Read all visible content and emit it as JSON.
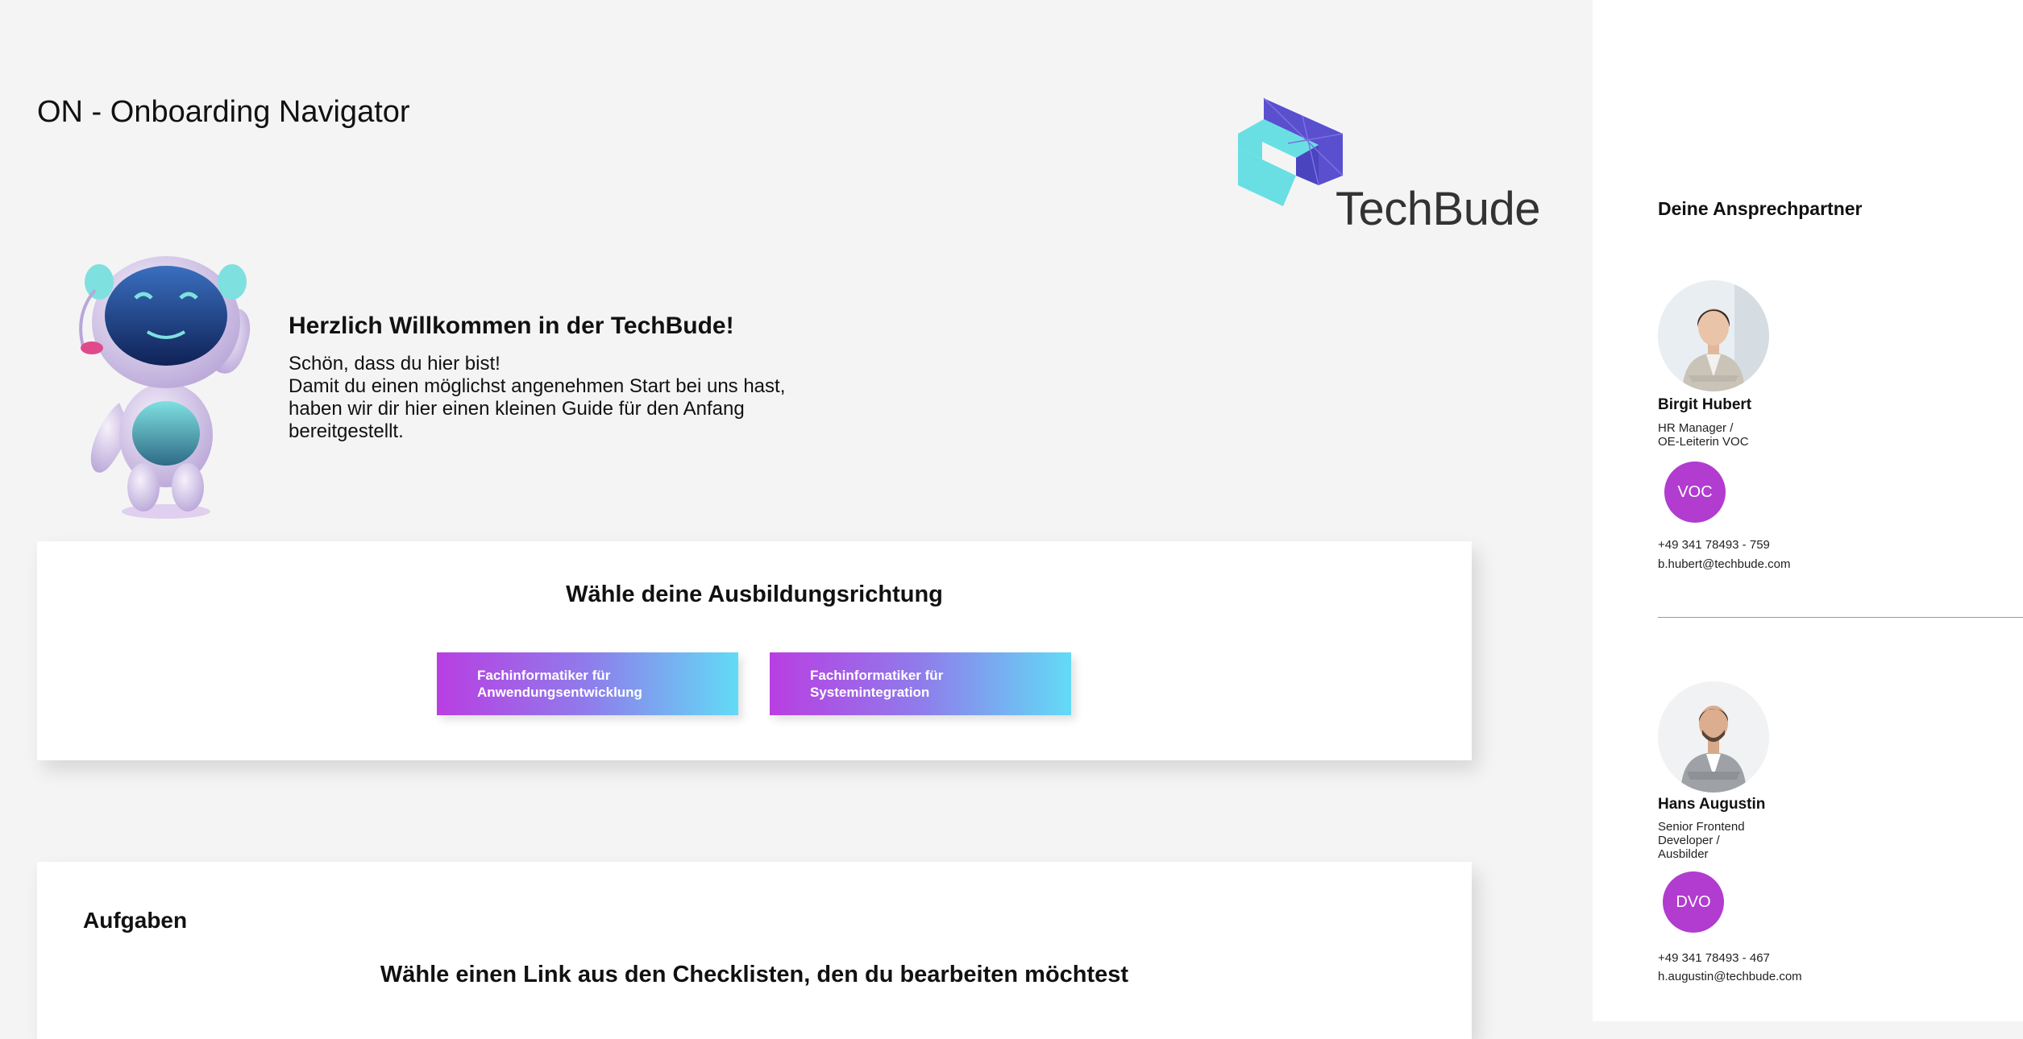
{
  "app": {
    "title": "ON - Onboarding Navigator"
  },
  "logo": {
    "text": "TechBude"
  },
  "welcome": {
    "heading": "Herzlich Willkommen in der TechBude!",
    "text": "Schön, dass du hier bist!\nDamit du einen möglichst angenehmen Start bei uns hast,\nhaben wir dir hier einen kleinen Guide für den Anfang\nbereitgestellt."
  },
  "direction": {
    "heading": "Wähle deine Ausbildungsrichtung",
    "buttons": [
      {
        "label": "Fachinformatiker für\nAnwendungsentwicklung"
      },
      {
        "label": "Fachinformatiker für\nSystemintegration"
      }
    ]
  },
  "tasks": {
    "title": "Aufgaben",
    "subtitle": "Wähle einen Link aus den Checklisten, den du bearbeiten möchtest"
  },
  "sidebar": {
    "heading": "Deine Ansprechpartner",
    "contacts": [
      {
        "name": "Birgit Hubert",
        "role": "HR Manager /\nOE-Leiterin VOC",
        "badge": "VOC",
        "phone": "+49 341 78493 - 759",
        "email": "b.hubert@techbude.com"
      },
      {
        "name": "Hans Augustin",
        "role": "Senior Frontend\nDeveloper /\nAusbilder",
        "badge": "DVO",
        "phone": "+49 341 78493 - 467",
        "email": "h.augustin@techbude.com"
      }
    ]
  },
  "colors": {
    "accent_purple": "#b13ccf",
    "gradient_start": "#b93ee2",
    "gradient_end": "#62dbf6",
    "logo_purple": "#5a4fcf",
    "logo_cyan": "#69dfe3"
  }
}
